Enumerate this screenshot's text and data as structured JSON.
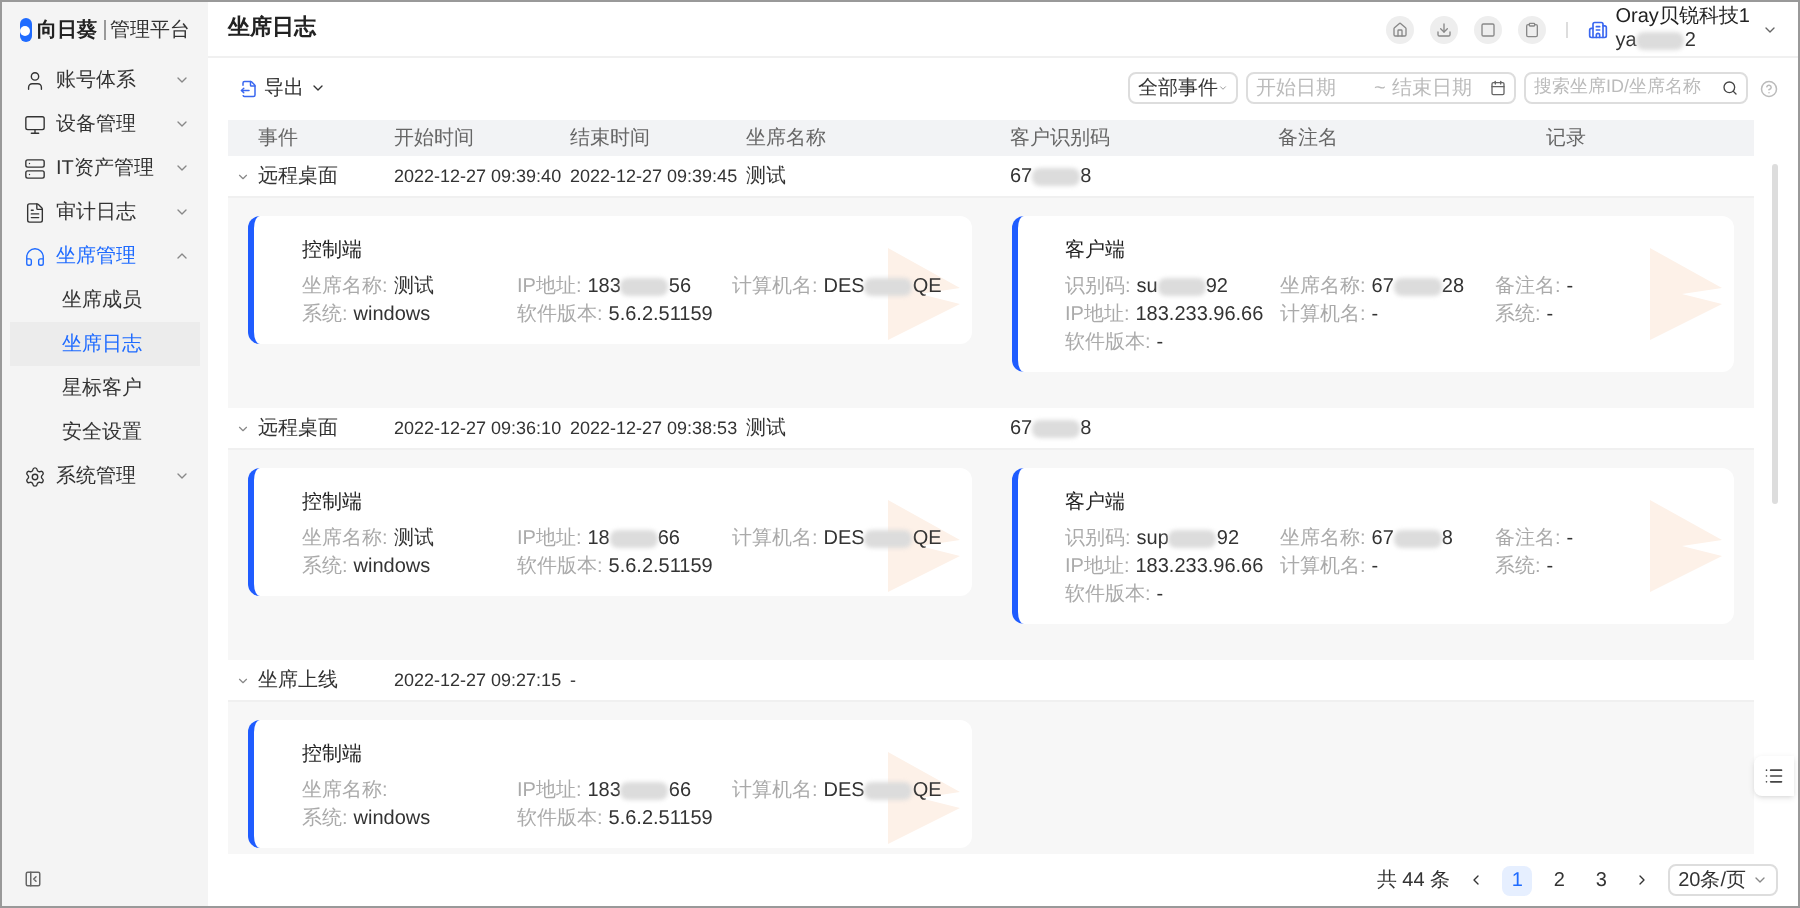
{
  "sidebar": {
    "brand": "向日葵",
    "product": "管理平台",
    "items": [
      {
        "label": "账号体系",
        "expanded": false,
        "selected": false
      },
      {
        "label": "设备管理",
        "expanded": false,
        "selected": false
      },
      {
        "label": "IT资产管理",
        "expanded": false,
        "selected": false
      },
      {
        "label": "审计日志",
        "expanded": false,
        "selected": false
      },
      {
        "label": "坐席管理",
        "expanded": true,
        "selected": true,
        "children": [
          {
            "label": "坐席成员",
            "selected": false
          },
          {
            "label": "坐席日志",
            "selected": true
          },
          {
            "label": "星标客户",
            "selected": false
          },
          {
            "label": "安全设置",
            "selected": false
          }
        ]
      },
      {
        "label": "系统管理",
        "expanded": false,
        "selected": false
      }
    ]
  },
  "header": {
    "title": "坐席日志",
    "user": {
      "company": "Oray贝锐科技1",
      "account": {
        "start": "ya",
        "end": "2"
      }
    }
  },
  "toolbar": {
    "export": "导出",
    "event_filter": "全部事件",
    "date_start": {
      "placeholder": "开始日期"
    },
    "date_separator": "~",
    "date_end": {
      "placeholder": "结束日期"
    },
    "search": {
      "placeholder": "搜索坐席ID/坐席名称"
    }
  },
  "table": {
    "columns": [
      "事件",
      "开始时间",
      "结束时间",
      "坐席名称",
      "客户识别码",
      "备注名",
      "记录"
    ],
    "rows": [
      {
        "event": "远程桌面",
        "start": "2022-12-27 09:39:40",
        "end": "2022-12-27 09:39:45",
        "seat": "测试",
        "customer_code": {
          "start": "67",
          "end": "8"
        },
        "expanded": true,
        "cards": [
          {
            "title": "控制端",
            "lines": [
              [
                {
                  "label": "坐席名称:",
                  "value": "测试"
                },
                {
                  "label": "IP地址:",
                  "redacted": {
                    "start": "183",
                    "end": "56"
                  }
                },
                {
                  "label": "计算机名:",
                  "redacted": {
                    "start": "DES",
                    "end": "QE"
                  }
                }
              ],
              [
                {
                  "label": "系统:",
                  "value": "windows"
                },
                {
                  "label": "软件版本:",
                  "value": "5.6.2.51159"
                }
              ]
            ]
          },
          {
            "title": "客户端",
            "lines": [
              [
                {
                  "label": "识别码:",
                  "redacted": {
                    "start": "su",
                    "end": "92"
                  }
                },
                {
                  "label": "坐席名称:",
                  "redacted": {
                    "start": "67",
                    "end": "28"
                  }
                },
                {
                  "label": "备注名:",
                  "value": "-"
                }
              ],
              [
                {
                  "label": "IP地址:",
                  "value": "183.233.96.66"
                },
                {
                  "label": "计算机名:",
                  "value": "-"
                },
                {
                  "label": "系统:",
                  "value": "-"
                }
              ],
              [
                {
                  "label": "软件版本:",
                  "value": "-"
                }
              ]
            ]
          }
        ]
      },
      {
        "event": "远程桌面",
        "start": "2022-12-27 09:36:10",
        "end": "2022-12-27 09:38:53",
        "seat": "测试",
        "customer_code": {
          "start": "67",
          "end": "8"
        },
        "expanded": true,
        "cards": [
          {
            "title": "控制端",
            "lines": [
              [
                {
                  "label": "坐席名称:",
                  "value": "测试"
                },
                {
                  "label": "IP地址:",
                  "redacted": {
                    "start": "18",
                    "end": "66"
                  }
                },
                {
                  "label": "计算机名:",
                  "redacted": {
                    "start": "DES",
                    "end": "QE"
                  }
                }
              ],
              [
                {
                  "label": "系统:",
                  "value": "windows"
                },
                {
                  "label": "软件版本:",
                  "value": "5.6.2.51159"
                }
              ]
            ]
          },
          {
            "title": "客户端",
            "lines": [
              [
                {
                  "label": "识别码:",
                  "redacted": {
                    "start": "sup",
                    "end": "92"
                  }
                },
                {
                  "label": "坐席名称:",
                  "redacted": {
                    "start": "67",
                    "end": "8"
                  }
                },
                {
                  "label": "备注名:",
                  "value": "-"
                }
              ],
              [
                {
                  "label": "IP地址:",
                  "value": "183.233.96.66"
                },
                {
                  "label": "计算机名:",
                  "value": "-"
                },
                {
                  "label": "系统:",
                  "value": "-"
                }
              ],
              [
                {
                  "label": "软件版本:",
                  "value": "-"
                }
              ]
            ]
          }
        ]
      },
      {
        "event": "坐席上线",
        "start": "2022-12-27 09:27:15",
        "end": "-",
        "expanded": true,
        "cards": [
          {
            "title": "控制端",
            "lines": [
              [
                {
                  "label": "坐席名称:"
                },
                {
                  "label": "IP地址:",
                  "redacted": {
                    "start": "183",
                    "end": "66"
                  }
                },
                {
                  "label": "计算机名:",
                  "redacted": {
                    "start": "DES",
                    "end": "QE"
                  }
                }
              ],
              [
                {
                  "label": "系统:",
                  "value": "windows"
                },
                {
                  "label": "软件版本:",
                  "value": "5.6.2.51159"
                }
              ]
            ]
          }
        ]
      }
    ]
  },
  "pagination": {
    "total": "共 44 条",
    "pages": [
      {
        "label": "1",
        "selected": true
      },
      {
        "label": "2",
        "selected": false
      },
      {
        "label": "3",
        "selected": false
      }
    ],
    "page_size": "20条/页"
  }
}
